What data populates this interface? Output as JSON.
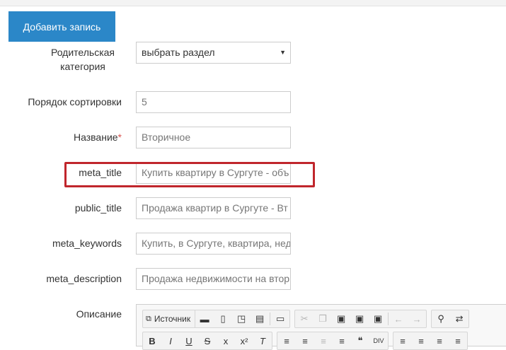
{
  "page": {
    "add_button_label": "Добавить запись"
  },
  "form": {
    "parent_category": {
      "label": "Родительская\nкатегория",
      "value": "выбрать раздел"
    },
    "sort_order": {
      "label": "Порядок сортировки",
      "value": "5"
    },
    "name": {
      "label": "Название",
      "required_mark": "*",
      "value": "Вторичное"
    },
    "meta_title": {
      "label": "meta_title",
      "value": "Купить квартиру в Сургуте - объ"
    },
    "public_title": {
      "label": "public_title",
      "value": "Продажа квартир в Сургуте - Вт"
    },
    "meta_keywords": {
      "label": "meta_keywords",
      "value": "Купить, в Сургуте, квартира, нед"
    },
    "meta_description": {
      "label": "meta_description",
      "value": "Продажа недвижимости на втор"
    },
    "description": {
      "label": "Описание"
    }
  },
  "editor": {
    "source_label": "Источник",
    "row1_icons": [
      "save-icon",
      "new-page-icon",
      "preview-icon",
      "print-icon",
      "templates-icon",
      "cut-icon",
      "copy-icon",
      "paste-icon",
      "paste-text-icon",
      "paste-word-icon",
      "undo-icon",
      "redo-icon",
      "find-icon",
      "replace-icon"
    ],
    "row2_glyphs": {
      "bold": "B",
      "italic": "I",
      "underline": "U",
      "strike": "S",
      "subscript": "x",
      "superscript": "x²",
      "remove_format": "T",
      "div": "DIV"
    }
  },
  "colors": {
    "primary_button": "#2b87c8",
    "highlight_border": "#c0262c",
    "required": "#d9534f"
  }
}
